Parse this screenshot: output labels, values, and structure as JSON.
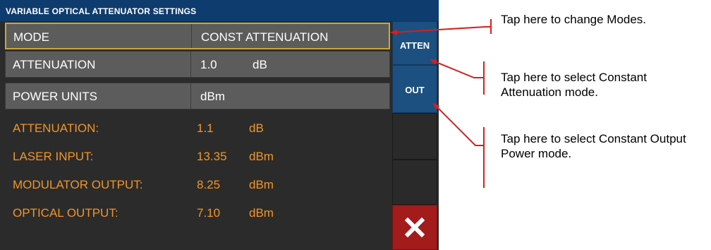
{
  "title": "VARIABLE OPTICAL ATTENUATOR SETTINGS",
  "settings": [
    {
      "label": "MODE",
      "value": "CONST ATTENUATION",
      "unit": ""
    },
    {
      "label": "ATTENUATION",
      "value": "1.0",
      "unit": "dB"
    },
    {
      "label": "POWER UNITS",
      "value": "dBm",
      "unit": ""
    }
  ],
  "readouts": [
    {
      "label": "ATTENUATION:",
      "value": "1.1",
      "unit": "dB"
    },
    {
      "label": "LASER INPUT:",
      "value": "13.35",
      "unit": "dBm"
    },
    {
      "label": "MODULATOR OUTPUT:",
      "value": "8.25",
      "unit": "dBm"
    },
    {
      "label": "OPTICAL OUTPUT:",
      "value": "7.10",
      "unit": "dBm"
    }
  ],
  "side_buttons": {
    "atten": "ATTEN",
    "out": "OUT",
    "close_icon": "close-icon"
  },
  "callouts": [
    "Tap here to change Modes.",
    "Tap here to select Constant Attenuation mode.",
    "Tap here to select Constant Output Power mode."
  ],
  "colors": {
    "title_bar": "#0f3c6e",
    "readout_text": "#f0952a",
    "selected_border": "#c9a83a",
    "side_button_blue": "#1c5080",
    "close_button": "#a31b1b",
    "callout_line": "#d42020"
  }
}
